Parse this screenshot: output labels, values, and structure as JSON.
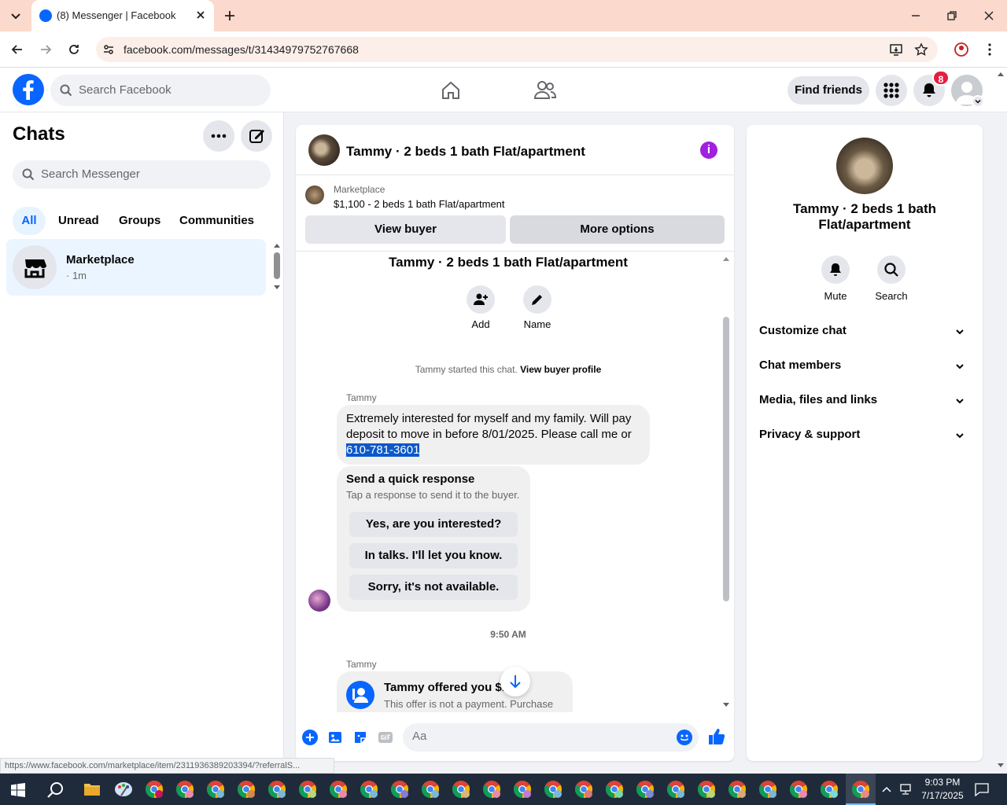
{
  "browser": {
    "tab_title": "(8) Messenger | Facebook",
    "url": "facebook.com/messages/t/31434979752767668"
  },
  "fb_header": {
    "search_placeholder": "Search Facebook",
    "find_friends": "Find friends",
    "notification_count": "8"
  },
  "chats": {
    "title": "Chats",
    "search_placeholder": "Search Messenger",
    "filters": [
      "All",
      "Unread",
      "Groups",
      "Communities"
    ],
    "items": [
      {
        "name": "Marketplace",
        "time": "· 1m"
      }
    ]
  },
  "conversation": {
    "title": "Tammy · 2 beds 1 bath Flat/apartment",
    "marketplace_label": "Marketplace",
    "listing": "$1,100 - 2 beds 1 bath Flat/apartment",
    "view_buyer": "View buyer",
    "more_options": "More options",
    "chat_heading": "Tammy · 2 beds 1 bath Flat/apartment",
    "actions": {
      "add": "Add",
      "name": "Name"
    },
    "started_text": "Tammy started this chat.",
    "view_buyer_profile": "View buyer profile",
    "sender": "Tammy",
    "message_text": "Extremely interested for myself and my family. Will pay deposit to move in before 8/01/2025. Please call me or",
    "phone": "610-781-3601",
    "quick_response": {
      "title": "Send a quick response",
      "subtitle": "Tap a response to send it to the buyer.",
      "options": [
        "Yes, are you interested?",
        "In talks. I'll let you know.",
        "Sorry, it's not available."
      ]
    },
    "timestamp": "9:50 AM",
    "sender2": "Tammy",
    "offer_title": "Tammy offered you $1,",
    "offer_subtitle": "This offer is not a payment. Purchase",
    "composer_placeholder": "Aa"
  },
  "info_panel": {
    "title": "Tammy · 2 beds 1 bath Flat/apartment",
    "mute": "Mute",
    "search": "Search",
    "sections": [
      "Customize chat",
      "Chat members",
      "Media, files and links",
      "Privacy & support"
    ]
  },
  "status_url": "https://www.facebook.com/marketplace/item/2311936389203394/?referralS...",
  "taskbar": {
    "time": "9:03 PM",
    "date": "7/17/2025"
  },
  "colors": {
    "accent": "#0866ff",
    "tabbar": "#fbd9cd",
    "badge": "#e41e3f",
    "info_icon": "#a020e0"
  }
}
